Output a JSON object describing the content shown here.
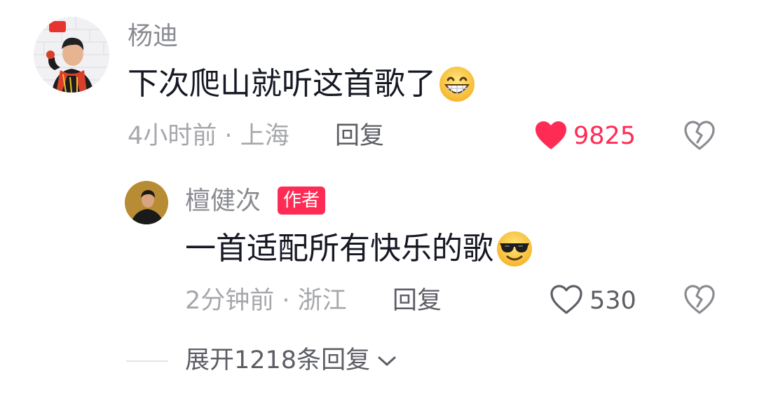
{
  "comment": {
    "username": "杨迪",
    "text": "下次爬山就听这首歌了",
    "emoji_icon": "grinning-face-icon",
    "time": "4小时前 · 上海",
    "reply_label": "回复",
    "likes": "9825",
    "liked": true,
    "like_color": "#fe2c55",
    "dislike_icon": "broken-heart-icon"
  },
  "reply": {
    "username": "檀健次",
    "badge": "作者",
    "badge_color": "#fe2c55",
    "text": "一首适配所有快乐的歌",
    "emoji_icon": "sunglasses-face-icon",
    "time": "2分钟前 · 浙江",
    "reply_label": "回复",
    "likes": "530",
    "liked": false,
    "dislike_icon": "broken-heart-icon"
  },
  "expand": {
    "label": "展开1218条回复",
    "icon": "chevron-down-icon"
  }
}
